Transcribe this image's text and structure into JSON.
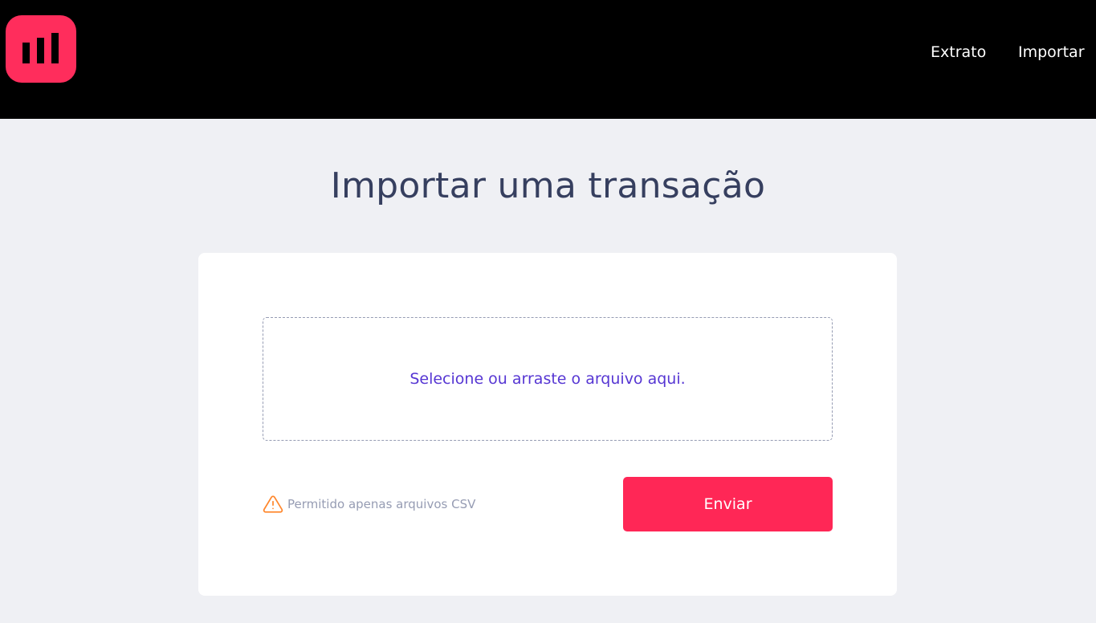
{
  "header": {
    "logo_icon": "bar-chart-logo-icon",
    "nav": [
      {
        "label": "Extrato"
      },
      {
        "label": "Importar"
      }
    ]
  },
  "main": {
    "title": "Importar uma transação",
    "upload": {
      "dropzone_text": "Selecione ou arraste o arquivo aqui.",
      "hint_icon": "alert-triangle-icon",
      "hint_text": "Permitido apenas arquivos CSV",
      "submit_label": "Enviar"
    }
  },
  "colors": {
    "header_bg": "#000000",
    "brand": "#ff2d5c",
    "page_bg": "#eff0f4",
    "title": "#363f5f",
    "dropzone_text": "#5636d3",
    "hint_icon": "#ff872c",
    "hint_text": "#969cb3",
    "button": "#ff2756"
  }
}
